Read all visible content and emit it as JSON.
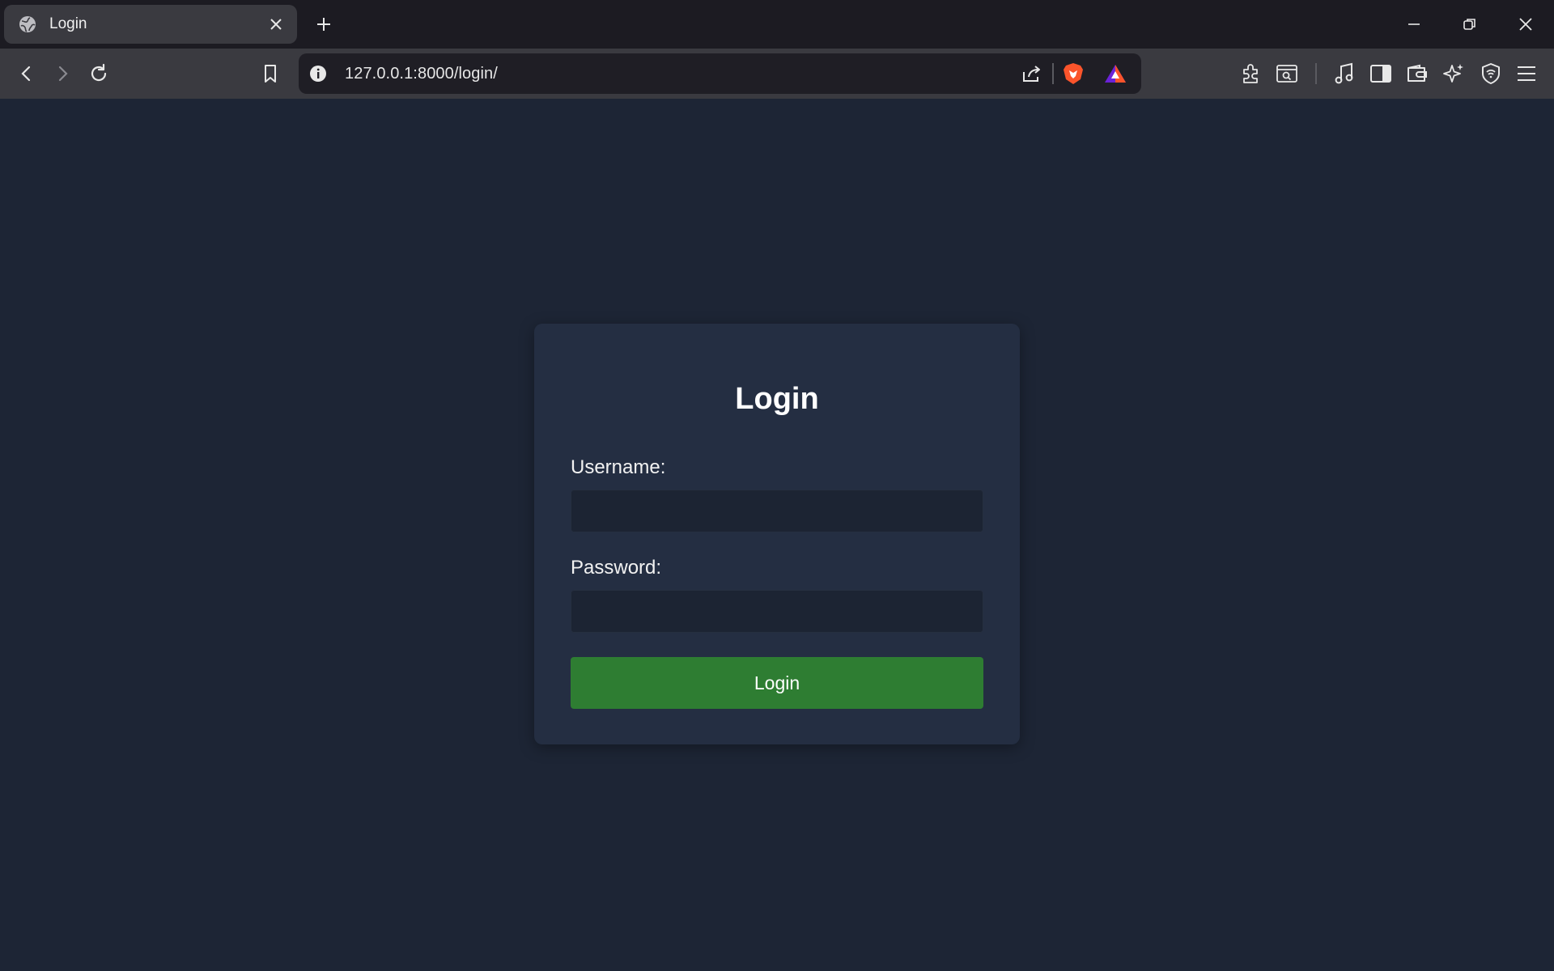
{
  "browser": {
    "tab_title": "Login",
    "url": "127.0.0.1:8000/login/",
    "colors": {
      "tabstrip": "#1c1b22",
      "toolbar": "#3a3a40",
      "omnibox": "#1f1e25",
      "brave_orange": "#fb542b"
    }
  },
  "page": {
    "background": "#1d2535",
    "card_background": "#242e42",
    "heading": "Login",
    "username_label": "Username:",
    "username_value": "",
    "password_label": "Password:",
    "password_value": "",
    "submit_label": "Login",
    "submit_color": "#2e7d32"
  }
}
